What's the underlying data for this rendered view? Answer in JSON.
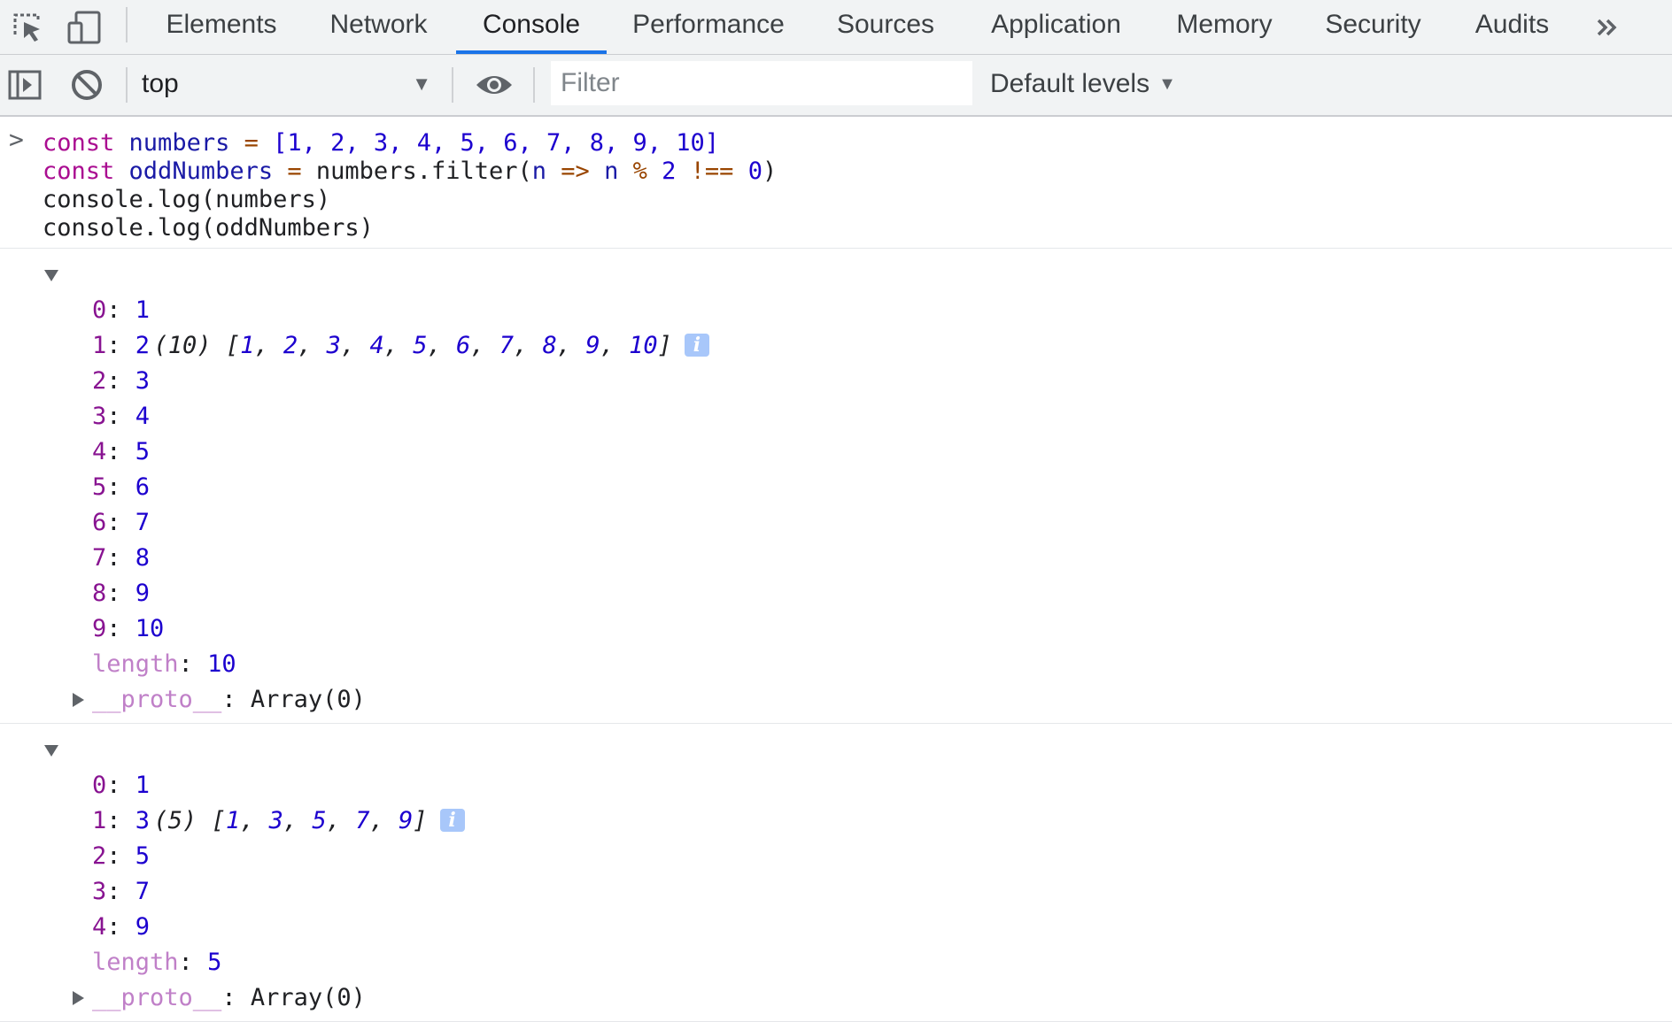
{
  "tabs": [
    {
      "label": "Elements",
      "active": false
    },
    {
      "label": "Network",
      "active": false
    },
    {
      "label": "Console",
      "active": true
    },
    {
      "label": "Performance",
      "active": false
    },
    {
      "label": "Sources",
      "active": false
    },
    {
      "label": "Application",
      "active": false
    },
    {
      "label": "Memory",
      "active": false
    },
    {
      "label": "Security",
      "active": false
    },
    {
      "label": "Audits",
      "active": false
    }
  ],
  "toolbar": {
    "context": "top",
    "filter_placeholder": "Filter",
    "levels_label": "Default levels"
  },
  "input": {
    "line1": {
      "kw": "const",
      "var": "numbers",
      "eq": "=",
      "arr": "[1, 2, 3, 4, 5, 6, 7, 8, 9, 10]"
    },
    "line2": {
      "kw": "const",
      "var": "oddNumbers",
      "eq": "=",
      "call": "numbers.filter(",
      "param": "n",
      "arrow": "=>",
      "expr_var": "n",
      "mod": "%",
      "two": "2",
      "neq": "!==",
      "zero": "0",
      "close": ")"
    },
    "line3": "console.log(numbers)",
    "line4": "console.log(oddNumbers)"
  },
  "outputs": [
    {
      "count": "(10)",
      "preview": [
        "1",
        "2",
        "3",
        "4",
        "5",
        "6",
        "7",
        "8",
        "9",
        "10"
      ],
      "items": [
        {
          "key": "0",
          "value": "1"
        },
        {
          "key": "1",
          "value": "2"
        },
        {
          "key": "2",
          "value": "3"
        },
        {
          "key": "3",
          "value": "4"
        },
        {
          "key": "4",
          "value": "5"
        },
        {
          "key": "5",
          "value": "6"
        },
        {
          "key": "6",
          "value": "7"
        },
        {
          "key": "7",
          "value": "8"
        },
        {
          "key": "8",
          "value": "9"
        },
        {
          "key": "9",
          "value": "10"
        }
      ],
      "length_key": "length",
      "length_value": "10",
      "proto_key": "__proto__",
      "proto_value": "Array(0)"
    },
    {
      "count": "(5)",
      "preview": [
        "1",
        "3",
        "5",
        "7",
        "9"
      ],
      "items": [
        {
          "key": "0",
          "value": "1"
        },
        {
          "key": "1",
          "value": "3"
        },
        {
          "key": "2",
          "value": "5"
        },
        {
          "key": "3",
          "value": "7"
        },
        {
          "key": "4",
          "value": "9"
        }
      ],
      "length_key": "length",
      "length_value": "5",
      "proto_key": "__proto__",
      "proto_value": "Array(0)"
    }
  ],
  "info_badge": "i",
  "colors": {
    "accent": "#1a73e8",
    "keyword": "#aa0d91",
    "number": "#1c00cf",
    "operator": "#994500",
    "property_key": "#881391"
  }
}
